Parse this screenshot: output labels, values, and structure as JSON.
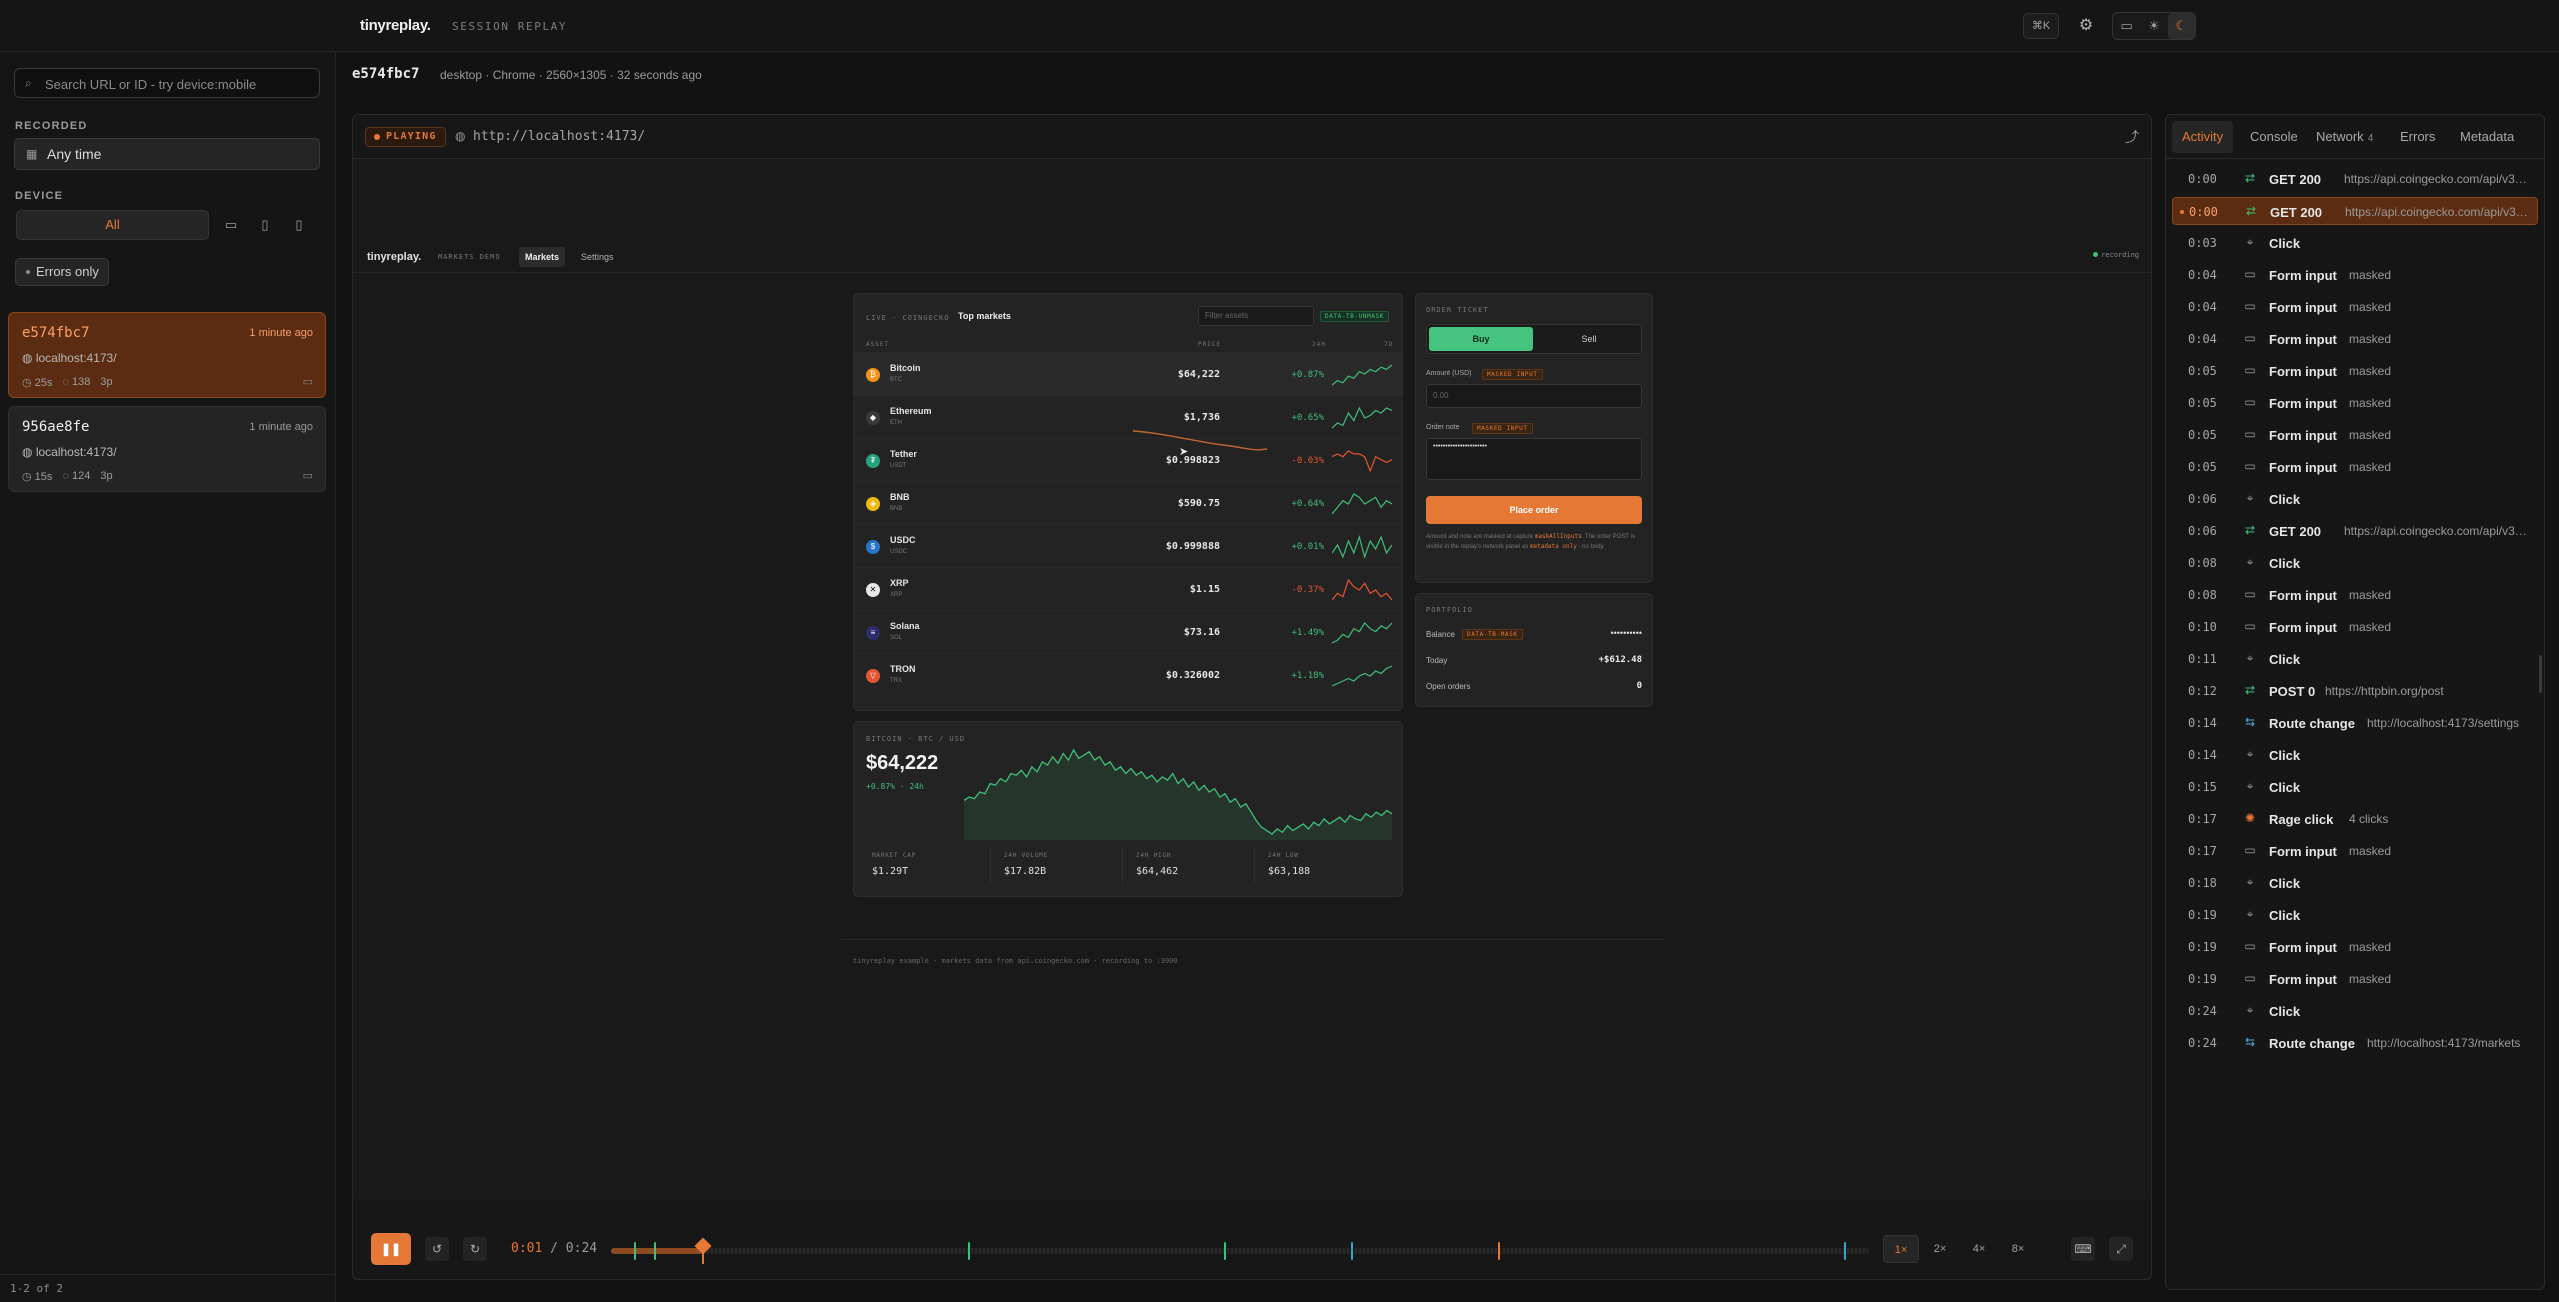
{
  "topbar": {
    "brand": "tinyreplay.",
    "subtitle": "SESSION REPLAY",
    "shortcut_label": "⌘K",
    "gear_icon": "gear-icon",
    "theme_icons": [
      "monitor-icon",
      "sun-icon",
      "moon-icon"
    ]
  },
  "sidebar": {
    "search_placeholder": "Search URL or ID - try device:mobile",
    "recorded_label": "RECORDED",
    "recorded_value": "Any time",
    "device_label": "DEVICE",
    "device_all": "All",
    "errors_only": "Errors only",
    "sessions": [
      {
        "id": "e574fbc7",
        "ago": "1 minute ago",
        "host": "localhost:4173/",
        "duration": "25s",
        "events": "138",
        "pages": "3p"
      },
      {
        "id": "956ae8fe",
        "ago": "1 minute ago",
        "host": "localhost:4173/",
        "duration": "15s",
        "events": "124",
        "pages": "3p"
      }
    ],
    "footer": "1-2 of 2"
  },
  "session": {
    "id": "e574fbc7",
    "meta": "desktop · Chrome · 2560×1305 · 32 seconds ago"
  },
  "player": {
    "status": "PLAYING",
    "url": "http://localhost:4173/",
    "current_time": "0:01",
    "total_time": "/ 0:24",
    "progress": 0.073,
    "speeds": [
      "1×",
      "2×",
      "4×",
      "8×"
    ],
    "active_speed": "1×",
    "markers": [
      {
        "pos": 0.018,
        "color": "#3fbf77"
      },
      {
        "pos": 0.034,
        "color": "#3fbf77"
      },
      {
        "pos": 0.284,
        "color": "#3fbf77"
      },
      {
        "pos": 0.487,
        "color": "#3fbf77"
      },
      {
        "pos": 0.588,
        "color": "#3aa5c9"
      },
      {
        "pos": 0.705,
        "color": "#e67836"
      },
      {
        "pos": 0.98,
        "color": "#3aa5c9"
      }
    ]
  },
  "demo": {
    "brand": "tinyreplay.",
    "sub": "MARKETS DEMO",
    "tabs": [
      "Markets",
      "Settings"
    ],
    "recording": "recording",
    "markets_kicker": "LIVE · COINGECKO",
    "markets_title": "Top markets",
    "filter_placeholder": "Filter assets",
    "tb_unmask": "DATA-TB-UNMASK",
    "col_asset": "ASSET",
    "col_price": "PRICE",
    "col_24h": "24H",
    "col_7d": "7D",
    "assets": [
      {
        "name": "Bitcoin",
        "sym": "BTC",
        "price": "$64,222",
        "chg": "+0.87%",
        "up": true,
        "color": "#f2931a",
        "glyph": "₿",
        "spark": [
          5,
          7,
          6,
          9,
          8,
          11,
          10,
          12,
          11,
          13,
          12,
          14
        ]
      },
      {
        "name": "Ethereum",
        "sym": "ETH",
        "price": "$1,736",
        "chg": "+0.65%",
        "up": true,
        "color": "#3a3a3a",
        "glyph": "◆",
        "spark": [
          4,
          6,
          5,
          10,
          7,
          12,
          8,
          9,
          11,
          10,
          12,
          11
        ]
      },
      {
        "name": "Tether",
        "sym": "USDT",
        "price": "$0.998823",
        "chg": "-0.03%",
        "up": false,
        "color": "#26a17b",
        "glyph": "₮",
        "spark": [
          9,
          10,
          9,
          11,
          10,
          10,
          9,
          4,
          9,
          8,
          7,
          8
        ]
      },
      {
        "name": "BNB",
        "sym": "BNB",
        "price": "$590.75",
        "chg": "+0.64%",
        "up": true,
        "color": "#f0b90b",
        "glyph": "◈",
        "spark": [
          6,
          8,
          10,
          9,
          12,
          11,
          9,
          10,
          11,
          8,
          10,
          9
        ]
      },
      {
        "name": "USDC",
        "sym": "USDC",
        "price": "$0.999888",
        "chg": "+0.01%",
        "up": true,
        "color": "#2775ca",
        "glyph": "$",
        "spark": [
          8,
          10,
          7,
          11,
          8,
          12,
          7,
          11,
          9,
          12,
          8,
          10
        ]
      },
      {
        "name": "XRP",
        "sym": "XRP",
        "price": "$1.15",
        "chg": "-0.37%",
        "up": false,
        "color": "#e8e8e8",
        "glyph": "✕",
        "spark": [
          6,
          8,
          7,
          12,
          10,
          9,
          11,
          8,
          9,
          7,
          8,
          6
        ]
      },
      {
        "name": "Solana",
        "sym": "SOL",
        "price": "$73.16",
        "chg": "+1.49%",
        "up": true,
        "color": "#2d2d6b",
        "glyph": "≡",
        "spark": [
          5,
          6,
          8,
          7,
          10,
          9,
          12,
          10,
          9,
          11,
          10,
          12
        ]
      },
      {
        "name": "TRON",
        "sym": "TRX",
        "price": "$0.326002",
        "chg": "+1.18%",
        "up": true,
        "color": "#e4562f",
        "glyph": "▽",
        "spark": [
          4,
          5,
          6,
          7,
          6,
          8,
          9,
          8,
          10,
          9,
          11,
          12
        ]
      }
    ],
    "btc_kicker": "BITCOIN · BTC / USD",
    "btc_price": "$64,222",
    "btc_change": "+0.87% · 24h",
    "btc_series": [
      42,
      44,
      43,
      47,
      46,
      52,
      51,
      55,
      53,
      58,
      57,
      60,
      56,
      62,
      59,
      65,
      63,
      68,
      64,
      70,
      66,
      72,
      67,
      69,
      71,
      66,
      68,
      63,
      65,
      60,
      62,
      58,
      61,
      57,
      59,
      55,
      57,
      53,
      56,
      54,
      58,
      52,
      55,
      50,
      53,
      48,
      51,
      47,
      49,
      44,
      46,
      41,
      43,
      38,
      40,
      35,
      30,
      26,
      24,
      22,
      25,
      23,
      27,
      24,
      26,
      28,
      25,
      29,
      27,
      31,
      28,
      30,
      32,
      29,
      33,
      31,
      30,
      34,
      32,
      35,
      33,
      36,
      34
    ],
    "stats": [
      {
        "k": "MARKET CAP",
        "v": "$1.29T"
      },
      {
        "k": "24H VOLUME",
        "v": "$17.82B"
      },
      {
        "k": "24H HIGH",
        "v": "$64,462"
      },
      {
        "k": "24H LOW",
        "v": "$63,188"
      }
    ],
    "order_kicker": "ORDER TICKET",
    "buy": "Buy",
    "sell": "Sell",
    "amount_label": "Amount (USD)",
    "masked_input": "MASKED INPUT",
    "amount_placeholder": "0.00",
    "note_label": "Order note",
    "note_value": "••••••••••••••••••••••",
    "place_order": "Place order",
    "order_hint_1": "Amount and note are masked at capture ",
    "order_hint_code": "maskAllInputs",
    "order_hint_2": ". The order POST is visible in the replay's network panel as ",
    "order_hint_code2": "metadata only",
    "order_hint_3": " - no body.",
    "portfolio_kicker": "PORTFOLIO",
    "balance_label": "Balance",
    "tb_mask": "DATA-TB-MASK",
    "balance_value": "••••••••••",
    "today_label": "Today",
    "today_value": "+$612.48",
    "open_label": "Open orders",
    "open_value": "0",
    "footer": "tinyreplay example · markets data from api.coingecko.com · recording to :3000"
  },
  "rpanel": {
    "tabs": [
      {
        "label": "Activity"
      },
      {
        "label": "Console"
      },
      {
        "label": "Network",
        "count": "4"
      },
      {
        "label": "Errors"
      },
      {
        "label": "Metadata"
      }
    ],
    "active_tab": "Activity",
    "events": [
      {
        "t": "0:00",
        "kind": "net",
        "label": "GET 200",
        "detail": "https://api.coingecko.com/api/v3/c..."
      },
      {
        "t": "0:00",
        "kind": "net",
        "label": "GET 200",
        "detail": "https://api.coingecko.com/api/v3/c...",
        "selected": true
      },
      {
        "t": "0:03",
        "kind": "click",
        "label": "Click",
        "detail": ""
      },
      {
        "t": "0:04",
        "kind": "form",
        "label": "Form input",
        "detail": "masked"
      },
      {
        "t": "0:04",
        "kind": "form",
        "label": "Form input",
        "detail": "masked"
      },
      {
        "t": "0:04",
        "kind": "form",
        "label": "Form input",
        "detail": "masked"
      },
      {
        "t": "0:05",
        "kind": "form",
        "label": "Form input",
        "detail": "masked"
      },
      {
        "t": "0:05",
        "kind": "form",
        "label": "Form input",
        "detail": "masked"
      },
      {
        "t": "0:05",
        "kind": "form",
        "label": "Form input",
        "detail": "masked"
      },
      {
        "t": "0:05",
        "kind": "form",
        "label": "Form input",
        "detail": "masked"
      },
      {
        "t": "0:06",
        "kind": "click",
        "label": "Click",
        "detail": ""
      },
      {
        "t": "0:06",
        "kind": "net",
        "label": "GET 200",
        "detail": "https://api.coingecko.com/api/v3/c..."
      },
      {
        "t": "0:08",
        "kind": "click",
        "label": "Click",
        "detail": ""
      },
      {
        "t": "0:08",
        "kind": "form",
        "label": "Form input",
        "detail": "masked"
      },
      {
        "t": "0:10",
        "kind": "form",
        "label": "Form input",
        "detail": "masked"
      },
      {
        "t": "0:11",
        "kind": "click",
        "label": "Click",
        "detail": ""
      },
      {
        "t": "0:12",
        "kind": "net",
        "label": "POST 0",
        "detail": "https://httpbin.org/post"
      },
      {
        "t": "0:14",
        "kind": "route",
        "label": "Route change",
        "detail": "http://localhost:4173/settings"
      },
      {
        "t": "0:14",
        "kind": "click",
        "label": "Click",
        "detail": ""
      },
      {
        "t": "0:15",
        "kind": "click",
        "label": "Click",
        "detail": ""
      },
      {
        "t": "0:17",
        "kind": "rage",
        "label": "Rage click",
        "detail": "4 clicks"
      },
      {
        "t": "0:17",
        "kind": "form",
        "label": "Form input",
        "detail": "masked"
      },
      {
        "t": "0:18",
        "kind": "click",
        "label": "Click",
        "detail": ""
      },
      {
        "t": "0:19",
        "kind": "click",
        "label": "Click",
        "detail": ""
      },
      {
        "t": "0:19",
        "kind": "form",
        "label": "Form input",
        "detail": "masked"
      },
      {
        "t": "0:19",
        "kind": "form",
        "label": "Form input",
        "detail": "masked"
      },
      {
        "t": "0:24",
        "kind": "click",
        "label": "Click",
        "detail": ""
      },
      {
        "t": "0:24",
        "kind": "route",
        "label": "Route change",
        "detail": "http://localhost:4173/markets"
      }
    ]
  },
  "colors": {
    "accent": "#e67836",
    "green": "#3fbf77",
    "red": "#e4562f"
  }
}
